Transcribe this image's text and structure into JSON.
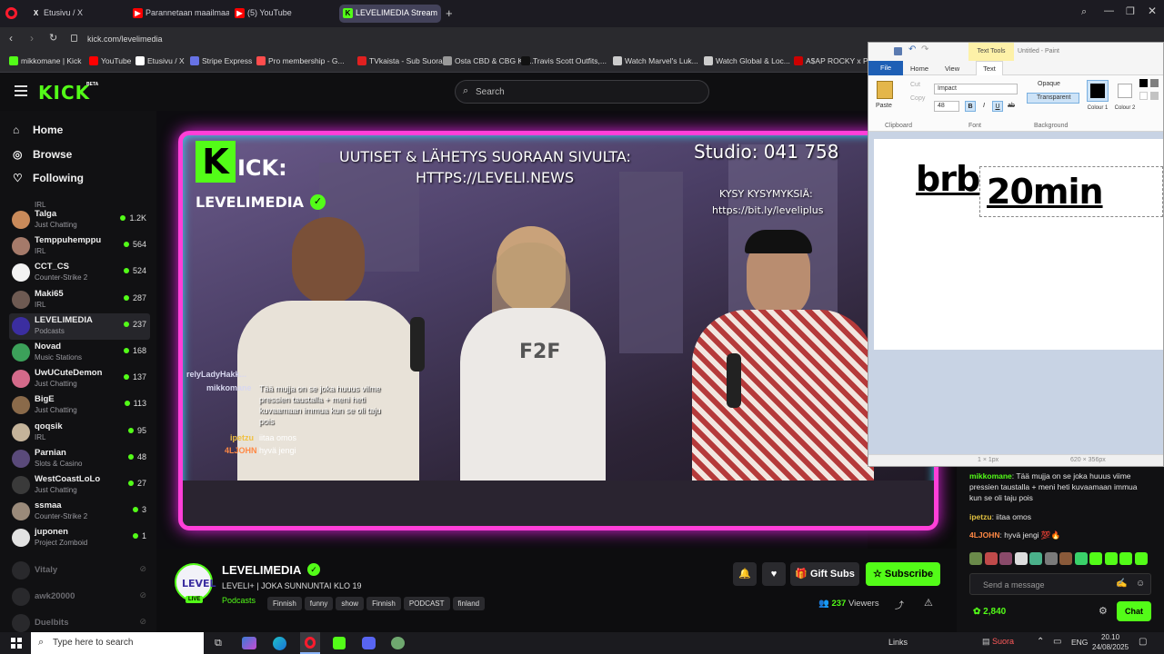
{
  "browser": {
    "tabs": [
      {
        "label": "Etusivu / X",
        "icon": "x-logo-icon"
      },
      {
        "label": "Parannetaan maailmaa fe",
        "icon": "youtube-icon"
      },
      {
        "label": "(5) YouTube",
        "icon": "youtube-icon"
      },
      {
        "label": "LEVELIMEDIA Stream",
        "icon": "kick-icon",
        "active": true
      }
    ],
    "url": "kick.com/levelimedia",
    "bookmarks": [
      "mikkomane | Kick",
      "YouTube",
      "Etusivu / X",
      "Stripe Express",
      "Pro membership - G...",
      "TVkaista - Sub Suora",
      "Osta CBD & CBG Ke...",
      "Travis Scott Outfits,...",
      "Watch Marvel's Luk...",
      "Watch Global & Loc...",
      "A$AP ROCKY x PU"
    ]
  },
  "kick": {
    "logo": "KICK",
    "beta": "BETA",
    "search_placeholder": "Search",
    "nav": [
      {
        "label": "Home",
        "icon": "home-icon"
      },
      {
        "label": "Browse",
        "icon": "compass-icon"
      },
      {
        "label": "Following",
        "icon": "heart-icon"
      }
    ],
    "partial_cat": "IRL",
    "channels": [
      {
        "name": "Talga",
        "category": "Just Chatting",
        "viewers": "1.2K",
        "color": "#c98a5a"
      },
      {
        "name": "Temppuhemppu",
        "category": "IRL",
        "viewers": "564",
        "color": "#a57a6a"
      },
      {
        "name": "CCT_CS",
        "category": "Counter-Strike 2",
        "viewers": "524",
        "color": "#f2f2f2"
      },
      {
        "name": "Maki65",
        "category": "IRL",
        "viewers": "287",
        "color": "#6e5a52"
      },
      {
        "name": "LEVELIMEDIA",
        "category": "Podcasts",
        "viewers": "237",
        "color": "#3b2ea0",
        "selected": true
      },
      {
        "name": "Novad",
        "category": "Music Stations",
        "viewers": "168",
        "color": "#3ca15a"
      },
      {
        "name": "UwUCuteDemon",
        "category": "Just Chatting",
        "viewers": "137",
        "color": "#d46a8a"
      },
      {
        "name": "BigE",
        "category": "Just Chatting",
        "viewers": "113",
        "color": "#8a6a4a"
      },
      {
        "name": "qoqsik",
        "category": "IRL",
        "viewers": "95",
        "color": "#c4b39a"
      },
      {
        "name": "Parnian",
        "category": "Slots & Casino",
        "viewers": "48",
        "color": "#5a4a7a"
      },
      {
        "name": "WestCoastLoLo",
        "category": "Just Chatting",
        "viewers": "27",
        "color": "#3a3a3a"
      },
      {
        "name": "ssmaa",
        "category": "Counter-Strike 2",
        "viewers": "3",
        "color": "#9a8a7a"
      },
      {
        "name": "juponen",
        "category": "Project Zomboid",
        "viewers": "1",
        "color": "#e2e2e2"
      }
    ],
    "offline": [
      "Vitaly",
      "awk20000",
      "Duelbits"
    ]
  },
  "stream": {
    "overlay_kick": "ICK:",
    "overlay_name": "LEVELIMEDIA",
    "headline_1": "UUTISET & LÄHETYS SUORAAN SIVULTA:",
    "headline_2": "HTTPS://LEVELI.NEWS",
    "studio": "Studio: 041 758",
    "ask_1": "KYSY KYSYMYKSIÄ:",
    "ask_2": "https://bit.ly/leveliplus",
    "chat_overlay": [
      {
        "user": "relyLadyHakk...",
        "text": ""
      },
      {
        "user": "mikkomane",
        "text": "Tää mujja on se joka huuus vilme pressien taustalla + meni heti kuvaamaan immua kun se oli taju pois"
      },
      {
        "user": "ipetzu",
        "text": "iitaa omos"
      },
      {
        "user": "4LJOHN",
        "text": "hyvä jengi"
      }
    ]
  },
  "channel_info": {
    "name": "LEVELIMEDIA",
    "title": "LEVELI+ | JOKA SUNNUNTAI KLO 19",
    "category": "Podcasts",
    "tags": [
      "Finnish",
      "funny",
      "show",
      "Finnish",
      "PODCAST",
      "finland"
    ],
    "gift_label": "Gift Subs",
    "subscribe_label": "Subscribe",
    "viewers": "237",
    "viewers_label": "Viewers",
    "live_badge": "LIVE"
  },
  "chat": {
    "messages": [
      {
        "user": "mikkomane",
        "text": "Tää mujja on se joka huuus viime pressien taustalla + meni heti kuvaamaan immua kun se oli taju pois",
        "color": "#53fc18"
      },
      {
        "user": "ipetzu",
        "text": "iitaa omos",
        "color": "#e0c040"
      },
      {
        "user": "4LJOHN",
        "text": "hyvä jengi 💯🔥",
        "color": "#ff8844"
      }
    ],
    "input_placeholder": "Send a message",
    "points": "2,840",
    "chat_button": "Chat"
  },
  "paint": {
    "title": "Untitled - Paint",
    "contextual_tab": "Text Tools",
    "tabs": [
      "File",
      "Home",
      "View",
      "Text"
    ],
    "groups": [
      "Clipboard",
      "Font",
      "Background"
    ],
    "paste": "Paste",
    "cut": "Cut",
    "copy": "Copy",
    "font_name": "Impact",
    "font_size": "48",
    "opaque": "Opaque",
    "transparent": "Transparent",
    "colour1": "Colour 1",
    "colour2": "Colour 2",
    "canvas_text_1": "brb",
    "canvas_text_2": "20min",
    "status_size": "1 × 1px",
    "status_canvas": "620 × 356px"
  },
  "taskbar": {
    "search_placeholder": "Type here to search",
    "links": "Links",
    "live": "Suora",
    "lang": "ENG",
    "time": "20.10",
    "date": "24/08/2025"
  }
}
